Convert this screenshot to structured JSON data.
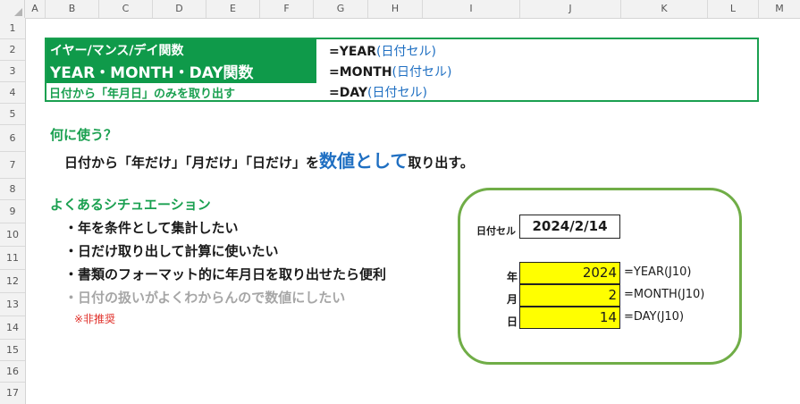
{
  "columns": [
    "A",
    "B",
    "C",
    "D",
    "E",
    "F",
    "G",
    "H",
    "I",
    "J",
    "K",
    "L",
    "M"
  ],
  "rows": [
    "1",
    "2",
    "3",
    "4",
    "5",
    "6",
    "7",
    "8",
    "9",
    "10",
    "11",
    "12",
    "13",
    "14",
    "15",
    "16",
    "17"
  ],
  "header_box": {
    "title_line1": "イヤー/マンス/デイ関数",
    "title_line2": "YEAR・MONTH・DAY関数",
    "title_line3": "日付から「年月日」のみを取り出す",
    "formulas": [
      {
        "prefix": "=YEAR",
        "arg": "(日付セル)"
      },
      {
        "prefix": "=MONTH",
        "arg": "(日付セル)"
      },
      {
        "prefix": "=DAY",
        "arg": "(日付セル)"
      }
    ]
  },
  "section1": {
    "heading": "何に使う？",
    "body_before": "日付から「年だけ」「月だけ」「日だけ」を",
    "body_emphasis": "数値として",
    "body_after": "取り出す。"
  },
  "section2": {
    "heading": "よくあるシチュエーション",
    "items": [
      "・年を条件として集計したい",
      "・日だけ取り出して計算に使いたい",
      "・書類のフォーマット的に年月日を取り出せたら便利",
      "・日付の扱いがよくわからんので数値にしたい"
    ],
    "note": "※非推奨"
  },
  "demo": {
    "date_label": "日付セル",
    "date_value": "2024/2/14",
    "results": [
      {
        "label": "年",
        "value": "2024",
        "formula": "=YEAR(J10)"
      },
      {
        "label": "月",
        "value": "2",
        "formula": "=MONTH(J10)"
      },
      {
        "label": "日",
        "value": "14",
        "formula": "=DAY(J10)"
      }
    ]
  },
  "colors": {
    "accent_green": "#1aa050",
    "header_fill": "#0f9a4a",
    "emphasis_blue": "#1f6fc2",
    "box_border": "#70ad47",
    "result_fill": "#ffff00",
    "note_red": "#e0302a",
    "muted_gray": "#a6a6a6"
  }
}
